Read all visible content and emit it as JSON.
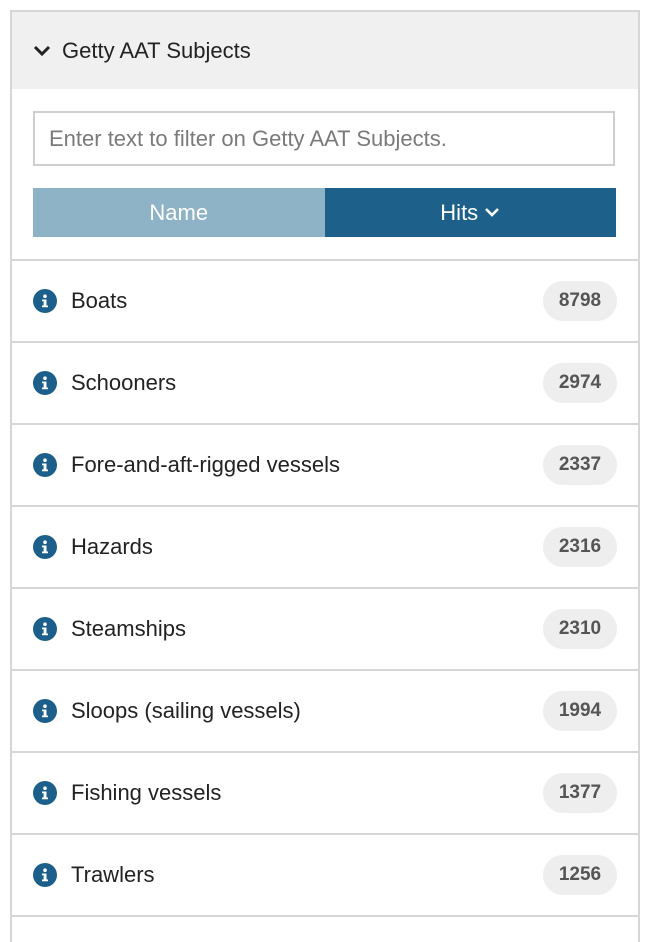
{
  "panel": {
    "title": "Getty AAT Subjects",
    "filter_placeholder": "Enter text to filter on Getty AAT Subjects.",
    "sort": {
      "name_label": "Name",
      "hits_label": "Hits"
    }
  },
  "colors": {
    "header_bg": "#f0f0f0",
    "sort_inactive": "#8eb2c6",
    "sort_active": "#1d6089",
    "info_icon": "#1d5f8b",
    "badge_bg": "#eeeeee"
  },
  "items": [
    {
      "label": "Boats",
      "count": "8798"
    },
    {
      "label": "Schooners",
      "count": "2974"
    },
    {
      "label": "Fore-and-aft-rigged vessels",
      "count": "2337"
    },
    {
      "label": "Hazards",
      "count": "2316"
    },
    {
      "label": "Steamships",
      "count": "2310"
    },
    {
      "label": "Sloops (sailing vessels)",
      "count": "1994"
    },
    {
      "label": "Fishing vessels",
      "count": "1377"
    },
    {
      "label": "Trawlers",
      "count": "1256"
    }
  ]
}
